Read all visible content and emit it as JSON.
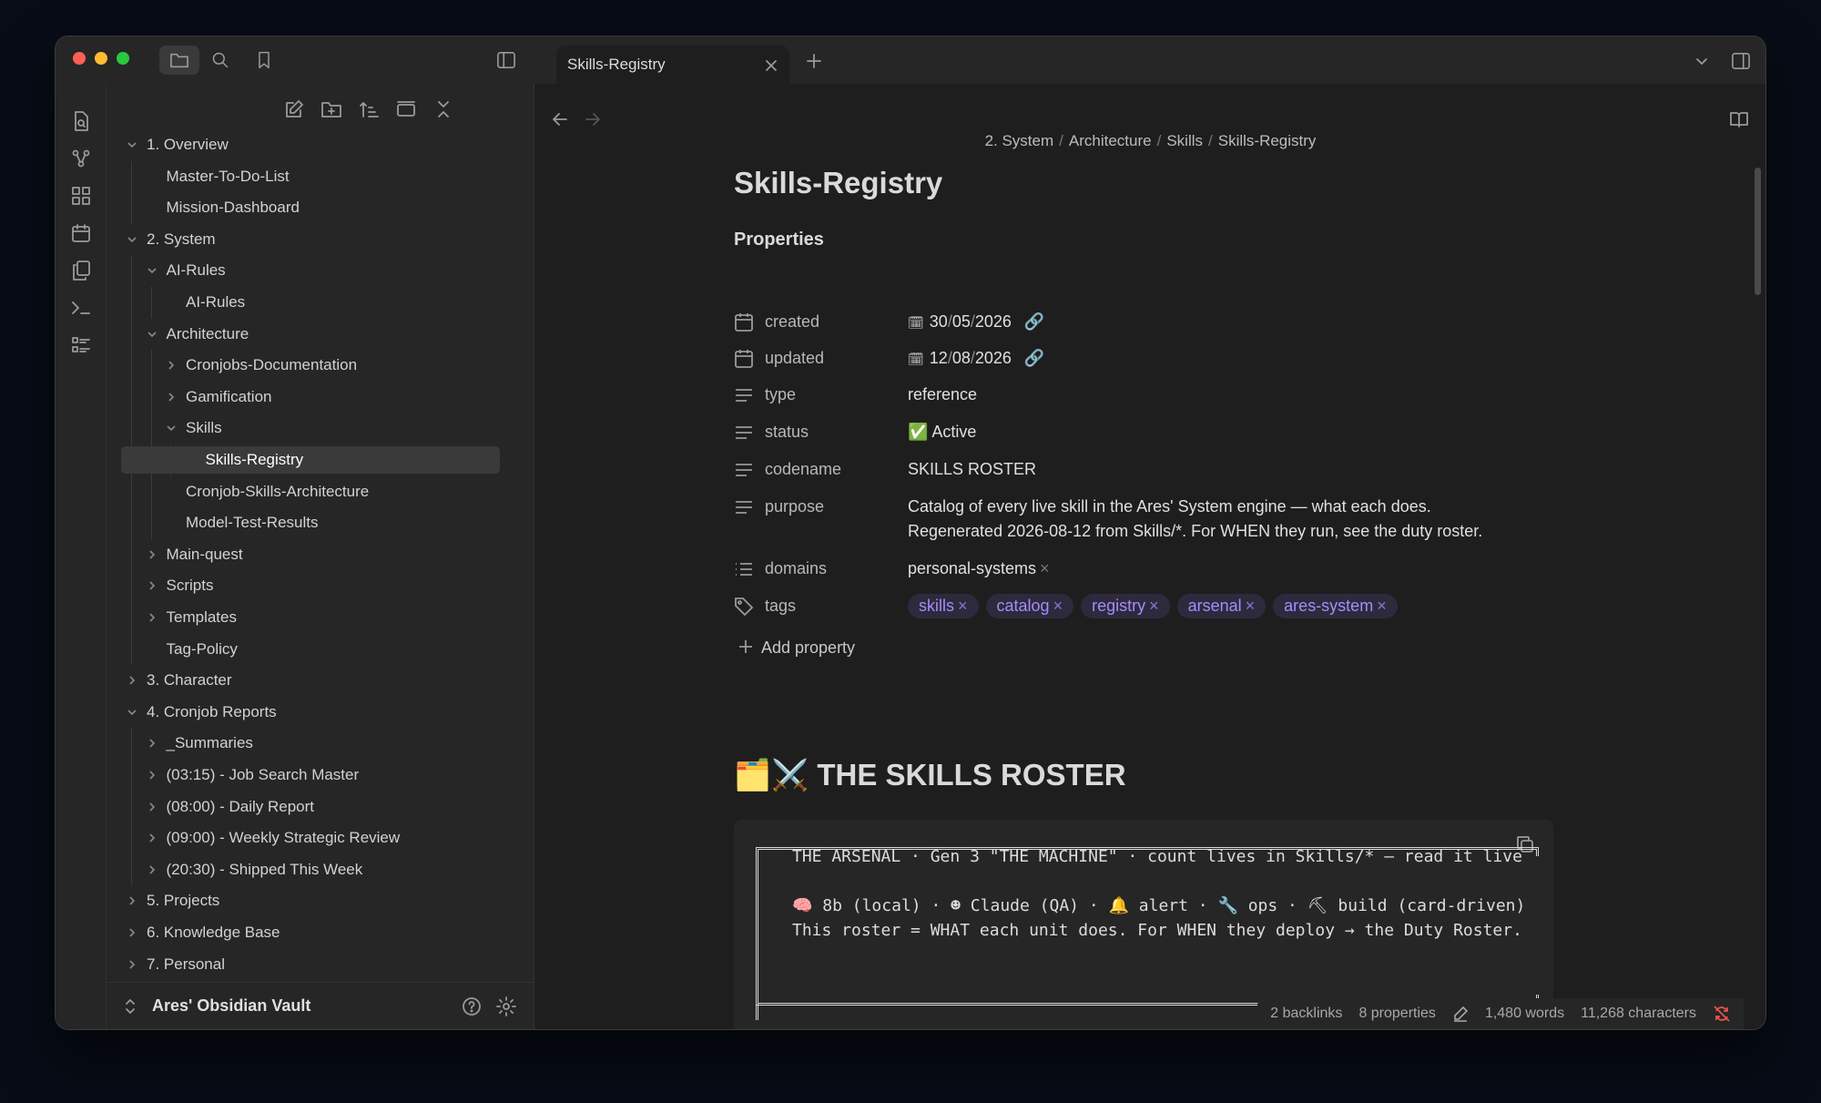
{
  "tab": {
    "title": "Skills-Registry"
  },
  "breadcrumb": [
    "2. System",
    "Architecture",
    "Skills",
    "Skills-Registry"
  ],
  "sidebar": {
    "tree": [
      {
        "label": "1. Overview",
        "depth": 0,
        "chevron": "down"
      },
      {
        "label": "Master-To-Do-List",
        "depth": 1,
        "chevron": ""
      },
      {
        "label": "Mission-Dashboard",
        "depth": 1,
        "chevron": ""
      },
      {
        "label": "2. System",
        "depth": 0,
        "chevron": "down"
      },
      {
        "label": "AI-Rules",
        "depth": 1,
        "chevron": "down"
      },
      {
        "label": "AI-Rules",
        "depth": 2,
        "chevron": ""
      },
      {
        "label": "Architecture",
        "depth": 1,
        "chevron": "down"
      },
      {
        "label": "Cronjobs-Documentation",
        "depth": 2,
        "chevron": "right"
      },
      {
        "label": "Gamification",
        "depth": 2,
        "chevron": "right"
      },
      {
        "label": "Skills",
        "depth": 2,
        "chevron": "down"
      },
      {
        "label": "Skills-Registry",
        "depth": 3,
        "chevron": "",
        "active": true
      },
      {
        "label": "Cronjob-Skills-Architecture",
        "depth": 2,
        "chevron": ""
      },
      {
        "label": "Model-Test-Results",
        "depth": 2,
        "chevron": ""
      },
      {
        "label": "Main-quest",
        "depth": 1,
        "chevron": "right"
      },
      {
        "label": "Scripts",
        "depth": 1,
        "chevron": "right"
      },
      {
        "label": "Templates",
        "depth": 1,
        "chevron": "right"
      },
      {
        "label": "Tag-Policy",
        "depth": 1,
        "chevron": ""
      },
      {
        "label": "3. Character",
        "depth": 0,
        "chevron": "right"
      },
      {
        "label": "4. Cronjob Reports",
        "depth": 0,
        "chevron": "down"
      },
      {
        "label": "_Summaries",
        "depth": 1,
        "chevron": "right"
      },
      {
        "label": "(03:15) - Job Search Master",
        "depth": 1,
        "chevron": "right"
      },
      {
        "label": "(08:00) - Daily Report",
        "depth": 1,
        "chevron": "right"
      },
      {
        "label": "(09:00) - Weekly Strategic Review",
        "depth": 1,
        "chevron": "right"
      },
      {
        "label": "(20:30) - Shipped This Week",
        "depth": 1,
        "chevron": "right"
      },
      {
        "label": "5. Projects",
        "depth": 0,
        "chevron": "right"
      },
      {
        "label": "6. Knowledge Base",
        "depth": 0,
        "chevron": "right"
      },
      {
        "label": "7. Personal",
        "depth": 0,
        "chevron": "right"
      }
    ],
    "vault_name": "Ares' Obsidian Vault"
  },
  "note": {
    "title": "Skills-Registry",
    "properties_heading": "Properties",
    "properties": {
      "created": {
        "key": "created",
        "d": "30",
        "m": "05",
        "y": "2026"
      },
      "updated": {
        "key": "updated",
        "d": "12",
        "m": "08",
        "y": "2026"
      },
      "type": {
        "key": "type",
        "value": "reference"
      },
      "status": {
        "key": "status",
        "value": "✅ Active"
      },
      "codename": {
        "key": "codename",
        "value": "SKILLS ROSTER"
      },
      "purpose": {
        "key": "purpose",
        "line1": "Catalog of every live skill in the Ares' System engine — what each does.",
        "line2": "Regenerated 2026-08-12 from Skills/*. For WHEN they run, see the duty roster."
      },
      "domains": {
        "key": "domains",
        "value": "personal-systems"
      },
      "tags": {
        "key": "tags",
        "values": [
          "skills",
          "catalog",
          "registry",
          "arsenal",
          "ares-system"
        ]
      }
    },
    "add_property": "Add property",
    "heading": "🗂️⚔️ THE SKILLS ROSTER",
    "code_lines": [
      "THE ARSENAL · Gen 3 \"THE MACHINE\" · count lives in Skills/* — read it live",
      "🧠 8b (local) · ☻ Claude (QA) · 🔔 alert · 🔧 ops · ⛏ build (card-driven)",
      "This roster = WHAT each unit does. For WHEN they deploy → the Duty Roster."
    ]
  },
  "statusbar": {
    "backlinks": "2 backlinks",
    "properties": "8 properties",
    "words": "1,480 words",
    "characters": "11,268 characters"
  },
  "colors": {
    "accent": "#a78bfa",
    "pill_bg": "#2d2a3d",
    "close": "#ff5f57",
    "minimize": "#febc2e",
    "zoom": "#28c840"
  }
}
